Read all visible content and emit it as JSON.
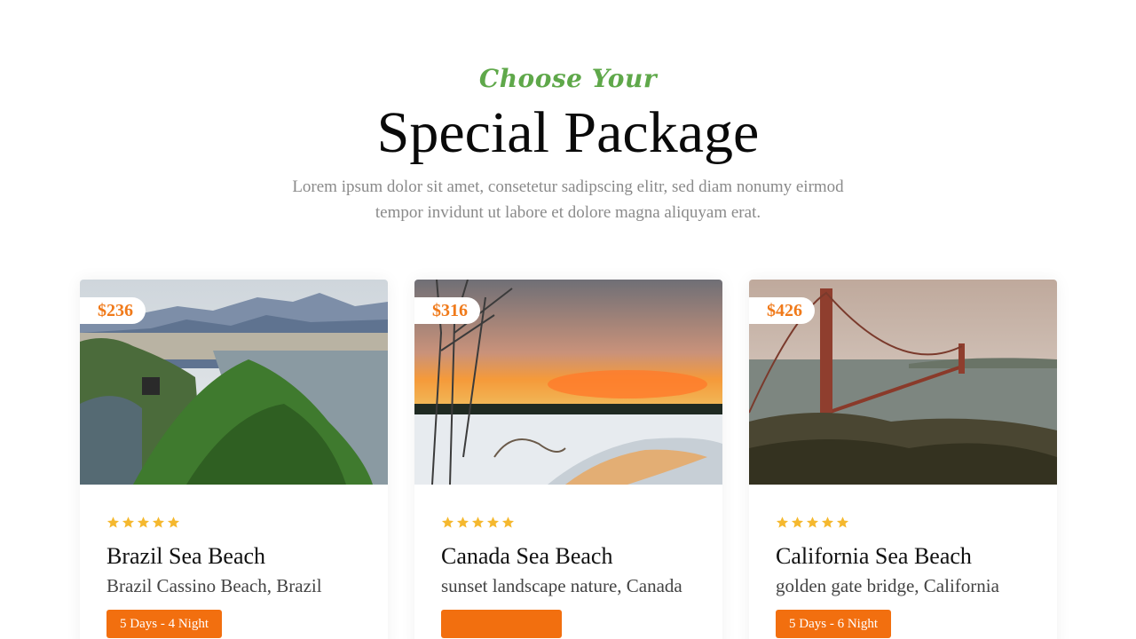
{
  "header": {
    "eyebrow": "Choose Your",
    "title": "Special Package",
    "subtitle": "Lorem ipsum dolor sit amet, consetetur sadipscing elitr, sed diam nonumy eirmod tempor invidunt ut labore et dolore magna aliquyam erat."
  },
  "colors": {
    "accent_green": "#5fa84a",
    "accent_orange": "#f26f0f",
    "star_yellow": "#f5b82e"
  },
  "packages": [
    {
      "price": "$236",
      "rating": 5,
      "title": "Brazil Sea Beach",
      "location": "Brazil Cassino Beach, Brazil",
      "duration": "5 Days - 4 Night",
      "image_icon": "mountain-coast-photo"
    },
    {
      "price": "$316",
      "rating": 5,
      "title": "Canada Sea Beach",
      "location": "sunset landscape nature, Canada",
      "duration": "",
      "image_icon": "snow-sunset-photo"
    },
    {
      "price": "$426",
      "rating": 5,
      "title": "California Sea Beach",
      "location": "golden gate bridge, California",
      "duration": "5 Days - 6 Night",
      "image_icon": "golden-gate-bridge-photo"
    }
  ]
}
